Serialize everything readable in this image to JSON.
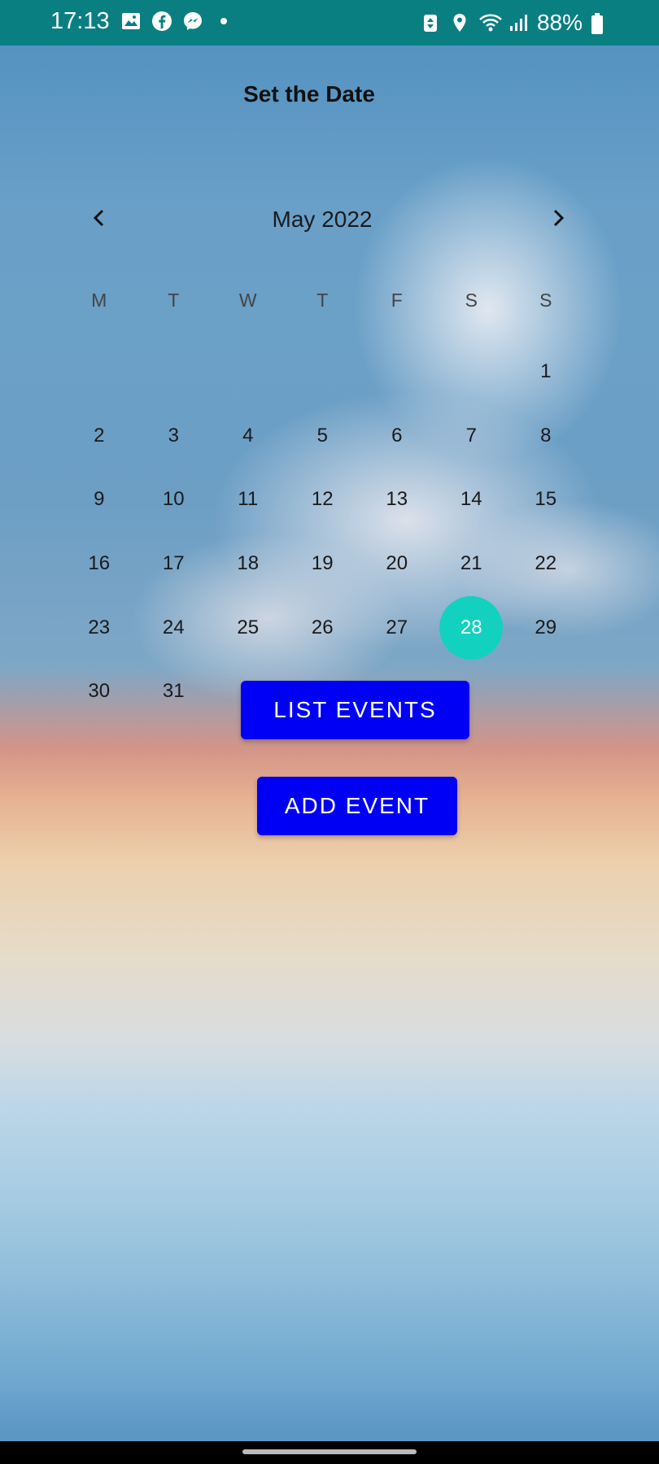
{
  "status_bar": {
    "time": "17:13",
    "battery": "88%",
    "left_icons": [
      "gallery-icon",
      "facebook-icon",
      "messenger-icon",
      "dot-icon"
    ],
    "right_icons": [
      "recycle-icon",
      "location-icon",
      "wifi-icon",
      "signal-icon",
      "battery-icon"
    ]
  },
  "page": {
    "title": "Set the Date"
  },
  "calendar": {
    "month_label": "May 2022",
    "weekdays": [
      "M",
      "T",
      "W",
      "T",
      "F",
      "S",
      "S"
    ],
    "leading_blanks": 6,
    "days": [
      "1",
      "2",
      "3",
      "4",
      "5",
      "6",
      "7",
      "8",
      "9",
      "10",
      "11",
      "12",
      "13",
      "14",
      "15",
      "16",
      "17",
      "18",
      "19",
      "20",
      "21",
      "22",
      "23",
      "24",
      "25",
      "26",
      "27",
      "28",
      "29",
      "30",
      "31"
    ],
    "selected_day": "28",
    "selected_color": "#12d1bf"
  },
  "buttons": {
    "list_events": "LIST EVENTS",
    "add_event": "ADD EVENT",
    "color": "#0000f5"
  }
}
